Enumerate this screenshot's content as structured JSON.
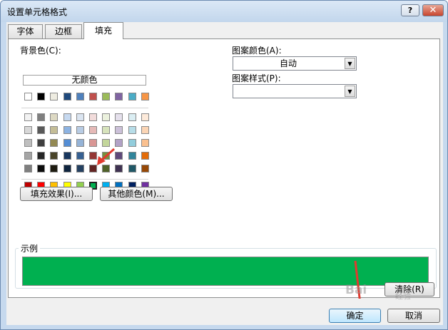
{
  "window": {
    "title": "设置单元格格式",
    "help_label": "?",
    "close_label": "✕"
  },
  "tabs": [
    {
      "label": "字体",
      "active": false
    },
    {
      "label": "边框",
      "active": false
    },
    {
      "label": "填充",
      "active": true
    }
  ],
  "fill": {
    "background_label": "背景色(C):",
    "no_color_label": "无颜色",
    "palette": {
      "basic_row": [
        "#ffffff",
        "#000000",
        "#eeece1",
        "#1f497d",
        "#4f81bd",
        "#c0504d",
        "#9bbb59",
        "#8064a2",
        "#4bacc6",
        "#f79646"
      ],
      "theme_rows": [
        [
          "#f2f2f2",
          "#7f7f7f",
          "#ddd9c3",
          "#c6d9f0",
          "#dbe5f1",
          "#f2dcdb",
          "#ebf1dd",
          "#e5e0ec",
          "#dbeef3",
          "#fdeada"
        ],
        [
          "#d8d8d8",
          "#595959",
          "#c4bd97",
          "#8db3e2",
          "#b8cce4",
          "#e5b9b7",
          "#d7e3bc",
          "#ccc1d9",
          "#b7dde8",
          "#fbd5b5"
        ],
        [
          "#bfbfbf",
          "#3f3f3f",
          "#938953",
          "#548dd4",
          "#95b3d7",
          "#d99694",
          "#c3d69b",
          "#b2a2c7",
          "#92cddc",
          "#fac08f"
        ],
        [
          "#a5a5a5",
          "#262626",
          "#494429",
          "#17365d",
          "#366092",
          "#953734",
          "#76923c",
          "#5f497a",
          "#31859b",
          "#e36c09"
        ],
        [
          "#7f7f7f",
          "#0c0c0c",
          "#1d1b10",
          "#0f243e",
          "#244061",
          "#632423",
          "#4f6128",
          "#3f3151",
          "#205867",
          "#974806"
        ]
      ],
      "standard_row": [
        "#c00000",
        "#ff0000",
        "#ffc000",
        "#ffff00",
        "#92d050",
        "#00b050",
        "#00b0f0",
        "#0070c0",
        "#002060",
        "#7030a0"
      ],
      "selected_color": "#00b050"
    },
    "fill_effects_label": "填充效果(I)...",
    "more_colors_label": "其他颜色(M)...",
    "pattern_color_label": "图案颜色(A):",
    "pattern_color_value": "自动",
    "pattern_style_label": "图案样式(P):",
    "pattern_style_value": "",
    "sample_label": "示例",
    "sample_color": "#00b050",
    "clear_label": "清除(R)"
  },
  "footer": {
    "ok_label": "确定",
    "cancel_label": "取消"
  },
  "watermark": {
    "text": "Bai",
    "sub": "经验"
  },
  "annotations": {
    "arrow_color": "#e03a2f"
  }
}
